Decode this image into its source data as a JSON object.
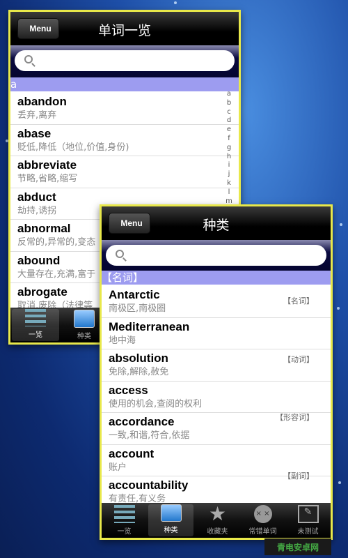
{
  "window1": {
    "back_label": "Menu",
    "title": "单词一览",
    "search_placeholder": "",
    "section": "a",
    "index": [
      "a",
      "b",
      "c",
      "d",
      "e",
      "f",
      "g",
      "h",
      "i",
      "j",
      "k",
      "l",
      "m"
    ],
    "rows": [
      {
        "word": "abandon",
        "meaning": "丢弃,离弃"
      },
      {
        "word": "abase",
        "meaning": "贬低,降低（地位,价值,身份)"
      },
      {
        "word": "abbreviate",
        "meaning": "节略,省略,缩写"
      },
      {
        "word": "abduct",
        "meaning": "劫持,诱拐"
      },
      {
        "word": "abnormal",
        "meaning": "反常的,异常的,变态"
      },
      {
        "word": "abound",
        "meaning": "大量存在,充满,富于"
      },
      {
        "word": "abrogate",
        "meaning": "取消,废除（法律等"
      }
    ],
    "tabs": [
      {
        "label": "一览",
        "icon": "list-icon",
        "selected": true
      },
      {
        "label": "种类",
        "icon": "cards-icon"
      }
    ]
  },
  "window2": {
    "back_label": "Menu",
    "title": "种类",
    "search_placeholder": "",
    "section": "【名词】",
    "rows": [
      {
        "word": "Antarctic",
        "meaning": "南极区,南极圈"
      },
      {
        "word": "Mediterranean",
        "meaning": "地中海"
      },
      {
        "word": "absolution",
        "meaning": "免除,解除,赦免"
      },
      {
        "word": "access",
        "meaning": "使用的机会,查阅的权利"
      },
      {
        "word": "accordance",
        "meaning": "一致,和谐,符合,依据"
      },
      {
        "word": "account",
        "meaning": "账户"
      },
      {
        "word": "accountability",
        "meaning": "有责任,有义务"
      }
    ],
    "tags": [
      "【名词】",
      "【动词】",
      "【形容词】",
      "【副词】"
    ],
    "tabs": [
      {
        "label": "一览",
        "icon": "list-icon"
      },
      {
        "label": "种类",
        "icon": "cards-icon",
        "selected": true
      },
      {
        "label": "收藏夹",
        "icon": "star-icon"
      },
      {
        "label": "常错单词",
        "icon": "sad-face-icon"
      },
      {
        "label": "未测试",
        "icon": "test-icon"
      }
    ]
  },
  "watermark": "青电安卓网"
}
